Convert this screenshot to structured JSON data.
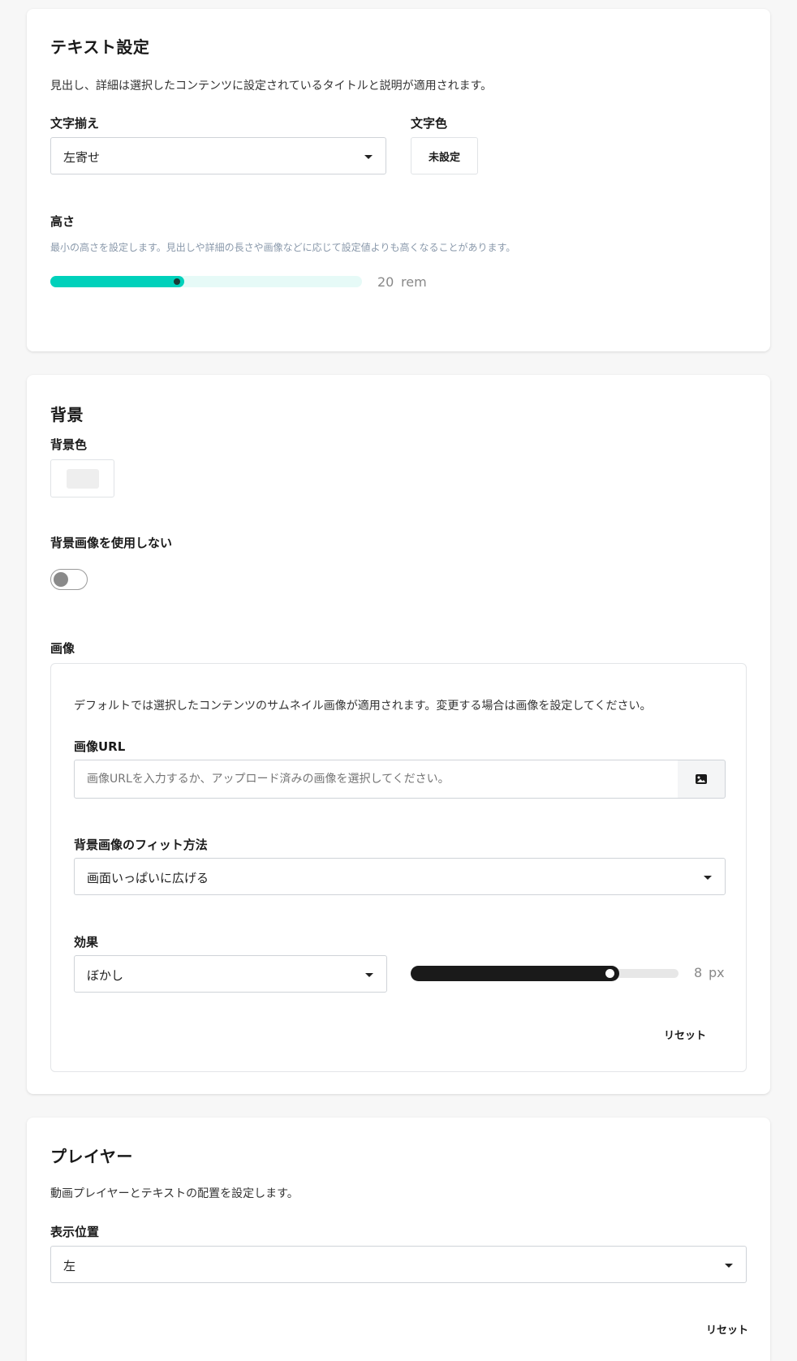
{
  "text_settings": {
    "title": "テキスト設定",
    "description": "見出し、詳細は選択したコンテンツに設定されているタイトルと説明が適用されます。",
    "align_label": "文字揃え",
    "align_value": "左寄せ",
    "color_label": "文字色",
    "color_button": "未設定",
    "height_label": "高さ",
    "height_hint": "最小の高さを設定します。見出しや詳細の長さや画像などに応じて設定値よりも高くなることがあります。",
    "height_value": "20",
    "height_fraction": 0.43,
    "height_unit": "rem",
    "slider_color": "#00d1bb"
  },
  "background": {
    "title": "背景",
    "color_label": "背景色",
    "swatch_color": "#eeeeee",
    "no_image_label": "背景画像を使用しない",
    "no_image_toggle": "off",
    "image_label": "画像",
    "image_description": "デフォルトでは選択したコンテンツのサムネイル画像が適用されます。変更する場合は画像を設定してください。",
    "image_url_label": "画像URL",
    "image_url_value": "",
    "image_url_placeholder": "画像URLを入力するか、アップロード済みの画像を選択してください。",
    "image_button_icon": "image-icon",
    "fit_label": "背景画像のフィット方法",
    "fit_value": "画面いっぱいに広げる",
    "effect_label": "効果",
    "effect_value": "ぼかし",
    "effect_amount": "8",
    "effect_fraction": 0.78,
    "effect_unit": "px",
    "reset_label": "リセット"
  },
  "player": {
    "title": "プレイヤー",
    "description": "動画プレイヤーとテキストの配置を設定します。",
    "position_label": "表示位置",
    "position_value": "左",
    "reset_label": "リセット"
  }
}
